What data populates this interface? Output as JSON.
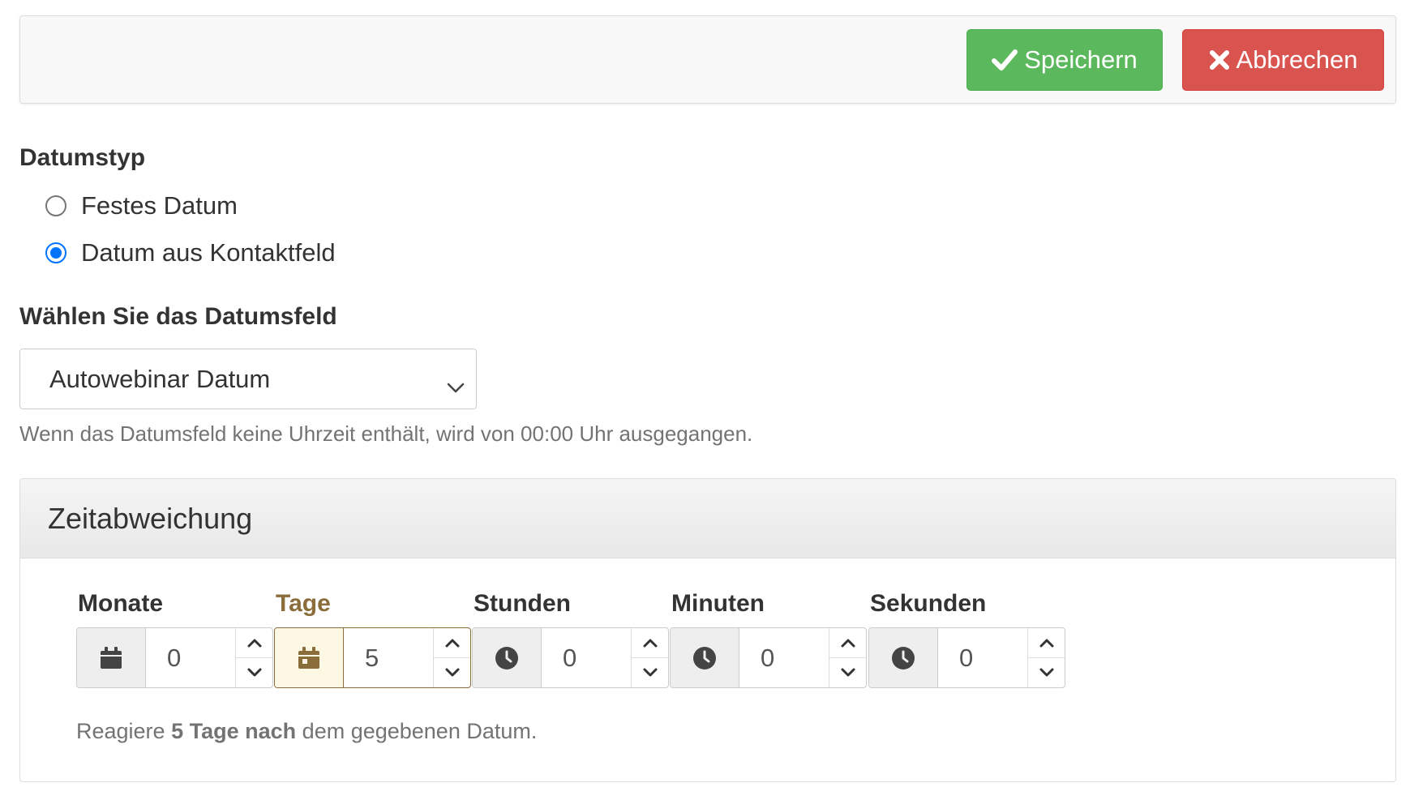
{
  "toolbar": {
    "save_label": "Speichern",
    "cancel_label": "Abbrechen",
    "save_color": "#5cb85c",
    "cancel_color": "#d9534f"
  },
  "date_type": {
    "label": "Datumstyp",
    "options": [
      {
        "label": "Festes Datum",
        "checked": false
      },
      {
        "label": "Datum aus Kontaktfeld",
        "checked": true
      }
    ]
  },
  "date_field": {
    "label": "Wählen Sie das Datumsfeld",
    "selected": "Autowebinar Datum",
    "help": "Wenn das Datumsfeld keine Uhrzeit enthält, wird von 00:00 Uhr ausgegangen."
  },
  "offset": {
    "title": "Zeitabweichung",
    "fields": [
      {
        "label": "Monate",
        "value": "0",
        "icon": "calendar-icon",
        "active": false
      },
      {
        "label": "Tage",
        "value": "5",
        "icon": "calendar-icon",
        "active": true
      },
      {
        "label": "Stunden",
        "value": "0",
        "icon": "clock-icon",
        "active": false
      },
      {
        "label": "Minuten",
        "value": "0",
        "icon": "clock-icon",
        "active": false
      },
      {
        "label": "Sekunden",
        "value": "0",
        "icon": "clock-icon",
        "active": false
      }
    ],
    "summary": {
      "prefix": "Reagiere",
      "bold": "5 Tage nach",
      "suffix": "dem gegebenen Datum."
    },
    "active_color": "#8a6d3b"
  }
}
